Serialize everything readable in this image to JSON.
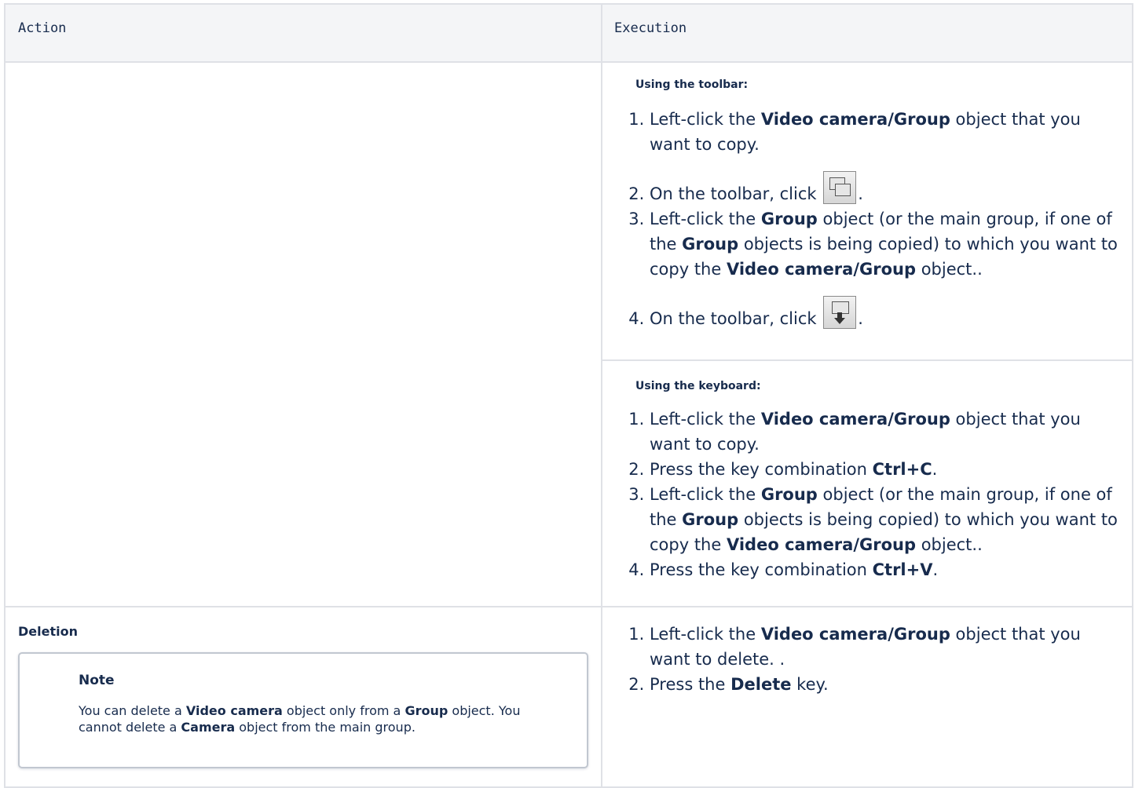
{
  "header": {
    "col_action": "Action",
    "col_execution": "Execution"
  },
  "row_copy": {
    "toolbar_section": {
      "title": "Using the toolbar:",
      "steps": [
        {
          "pre": "Left-click the ",
          "b1": "Video camera/Group",
          "mid": " object that you want to copy.",
          "b2": "",
          "post": ""
        },
        {
          "pre": "On the toolbar, click ",
          "icon": "copy-icon",
          "post": "."
        },
        {
          "pre": "Left-click the ",
          "b1": "Group",
          "mid": " object (or the main group, if one of the ",
          "b2": "Group",
          "mid2": " objects is being copied) to which you want to copy the ",
          "b3": "Video camera/Group",
          "post": " object.."
        },
        {
          "pre": "On the toolbar, click ",
          "icon": "paste-icon",
          "post": "."
        }
      ]
    },
    "keyboard_section": {
      "title": "Using the keyboard:",
      "steps": [
        {
          "pre": "Left-click the ",
          "b1": "Video camera/Group",
          "post": " object that you want to copy."
        },
        {
          "pre": "Press the key combination ",
          "b1": "Ctrl+C",
          "post": "."
        },
        {
          "pre": "Left-click the ",
          "b1": "Group",
          "mid": " object (or the main group, if one of the ",
          "b2": "Group",
          "mid2": " objects is being copied) to which you want to copy the ",
          "b3": "Video camera/Group",
          "post": " object.."
        },
        {
          "pre": "Press the key combination ",
          "b1": "Ctrl+V",
          "post": "."
        }
      ]
    }
  },
  "row_delete": {
    "action_title": "Deletion",
    "note": {
      "title": "Note",
      "t1": "You can delete a ",
      "b1": "Video camera",
      "t2": " object only from a ",
      "b2": "Group",
      "t3": " object. You cannot delete a ",
      "b3": "Camera",
      "t4": " object from the main group."
    },
    "steps": [
      {
        "pre": "Left-click the ",
        "b1": "Video camera/Group",
        "post": " object that you want to delete. ."
      },
      {
        "pre": "Press the ",
        "b1": "Delete",
        "post": " key."
      }
    ]
  }
}
